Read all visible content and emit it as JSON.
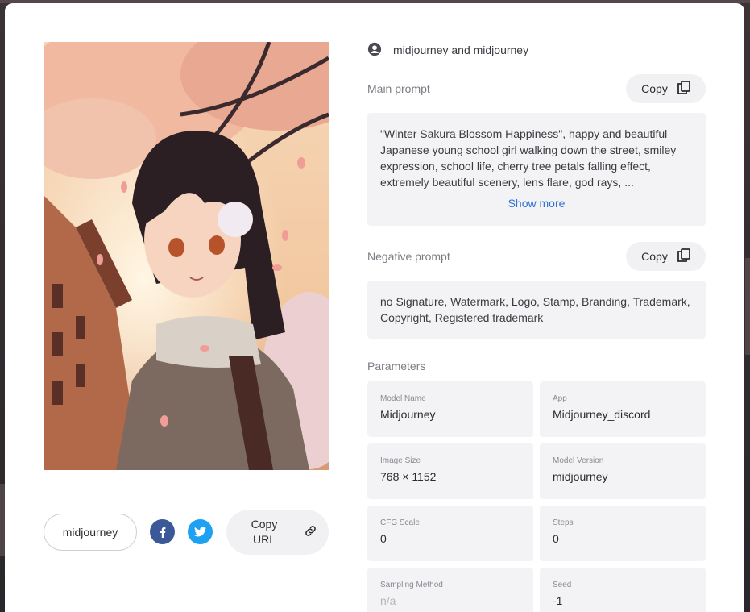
{
  "author": {
    "text": "midjourney and midjourney",
    "icon": "user-circle-icon"
  },
  "main_prompt": {
    "label": "Main prompt",
    "copy_label": "Copy",
    "text": "\"Winter Sakura Blossom Happiness\", happy and beautiful Japanese young school girl walking down the street, smiley expression, school life, cherry tree petals falling effect, extremely beautiful scenery, lens flare, god rays, ...",
    "show_more": "Show more"
  },
  "negative_prompt": {
    "label": "Negative prompt",
    "copy_label": "Copy",
    "text": "no Signature, Watermark, Logo, Stamp, Branding, Trademark, Copyright, Registered trademark"
  },
  "parameters": {
    "label": "Parameters",
    "items": [
      {
        "key": "Model Name",
        "value": "Midjourney"
      },
      {
        "key": "App",
        "value": "Midjourney_discord"
      },
      {
        "key": "Image Size",
        "value": "768 × 1152"
      },
      {
        "key": "Model Version",
        "value": "midjourney"
      },
      {
        "key": "CFG Scale",
        "value": "0"
      },
      {
        "key": "Steps",
        "value": "0"
      },
      {
        "key": "Sampling Method",
        "value": "n/a"
      },
      {
        "key": "Seed",
        "value": "-1"
      }
    ]
  },
  "footer": {
    "tag": "midjourney",
    "copy_url_label": "Copy URL",
    "icons": [
      "facebook-icon",
      "twitter-icon",
      "link-icon"
    ]
  },
  "colors": {
    "link": "#2f74d0",
    "facebook": "#3b5998",
    "twitter": "#1da1f2",
    "panel": "#f3f3f5"
  }
}
